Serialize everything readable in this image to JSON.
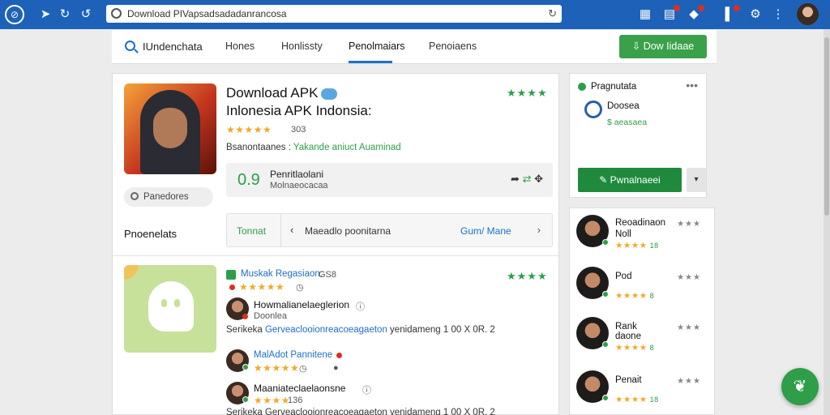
{
  "browser": {
    "url": "Download PIVapsadsadadanrancosa",
    "notifications": [
      "1",
      "1",
      "1"
    ]
  },
  "nav": {
    "brand": "IUndenchata",
    "tabs": [
      "Hones",
      "Honlissty",
      "Penolmaiars",
      "Penoiaens"
    ],
    "active_tab": "Penolmaiars",
    "download_label": "Dow Iidaae"
  },
  "app": {
    "title": "Download APK",
    "subtitle": "Inlonesia APK Indonsia:",
    "stars": "★★★★",
    "rating_stars": "★★★★★",
    "rating_count": "303",
    "desc_prefix": "Bsanontaanes :",
    "desc_highlight": "Yakande aniuct Auaminad",
    "version_number": "0.9",
    "version_label": "Penritlaolani",
    "version_sub": "Molnaeocacaa",
    "pill_label": "Panedores",
    "section_title": "Pnoenelats",
    "format_label": "Tonnat",
    "format_text": "Maeadlo poonitarna",
    "format_link": "Gum/ Mane"
  },
  "review": {
    "header": "Muskak Regasiaon:",
    "header_count": "GS8",
    "stars": "★★★★",
    "rating_stars": "★★★★★",
    "user1_name": "Howmalianelaeglerion",
    "user1_meta": "Doonlea",
    "body_prefix": "Serikeka",
    "body_highlight": "Gerveaclooionreacoeagaeton",
    "body_suffix": "yenidameng 1 00 X 0R. 2",
    "user2_name": "MalAdot Pannitene",
    "user2_stars": "★★★★★",
    "user3_name": "Maaniateclaelaonsne",
    "user3_stars": "★★★★",
    "user3_count": "136",
    "body2": "Serikeka Gerveaclooionreacoeagaeton yenidameng 1 00 X 0R. 2"
  },
  "side": {
    "title": "Pragnutata",
    "more": "•••",
    "name": "Doosea",
    "sub": "$ aeasaea",
    "button": "Pwnalnaeei"
  },
  "users": [
    {
      "name": "Reoadinaon",
      "name2": "Noll",
      "stars": "★★★★",
      "count": "18",
      "more": "★★★"
    },
    {
      "name": "Pod",
      "name2": "",
      "stars": "★★★★",
      "count": "8",
      "more": "★★★"
    },
    {
      "name": "Rank",
      "name2": "daone",
      "stars": "★★★★",
      "count": "8",
      "more": "★★★"
    },
    {
      "name": "Penait",
      "name2": "",
      "stars": "★★★★",
      "count": "18",
      "more": "★★★"
    }
  ]
}
